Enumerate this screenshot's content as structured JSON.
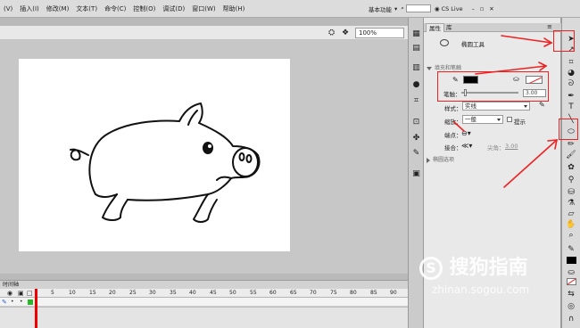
{
  "menu": [
    "(V)",
    "插入(I)",
    "修改(M)",
    "文本(T)",
    "命令(C)",
    "控制(O)",
    "调试(D)",
    "窗口(W)",
    "帮助(H)"
  ],
  "top_right": {
    "workspace": "基本功能",
    "search_label": "CS Live"
  },
  "zoom": "100%",
  "timeline": {
    "title": "时间轴",
    "ticks": [
      "5",
      "10",
      "15",
      "20",
      "25",
      "30",
      "35",
      "40",
      "45",
      "50",
      "55",
      "60",
      "65",
      "70",
      "75",
      "80",
      "85",
      "90",
      "95"
    ]
  },
  "panel": {
    "tabs": [
      "属性",
      "库"
    ],
    "tool_name": "椭圆工具",
    "section_fill": "填充和笔触",
    "stroke_label": "笔触：",
    "stroke_value": "3.00",
    "style_label": "样式：",
    "style_value": "实线",
    "scale_label": "缩放：",
    "scale_value": "一般",
    "hint_label": "提示",
    "cap_label": "端点：",
    "join_label": "接合：",
    "miter_label": "尖角：",
    "miter_value": "3.00",
    "section_ellipse": "椭圆选项"
  },
  "colors": {
    "stroke": "#000000",
    "accent_annotation": "#e22222"
  },
  "watermark": {
    "text": "搜狗指南",
    "url": "zhinan.sogou.com"
  }
}
